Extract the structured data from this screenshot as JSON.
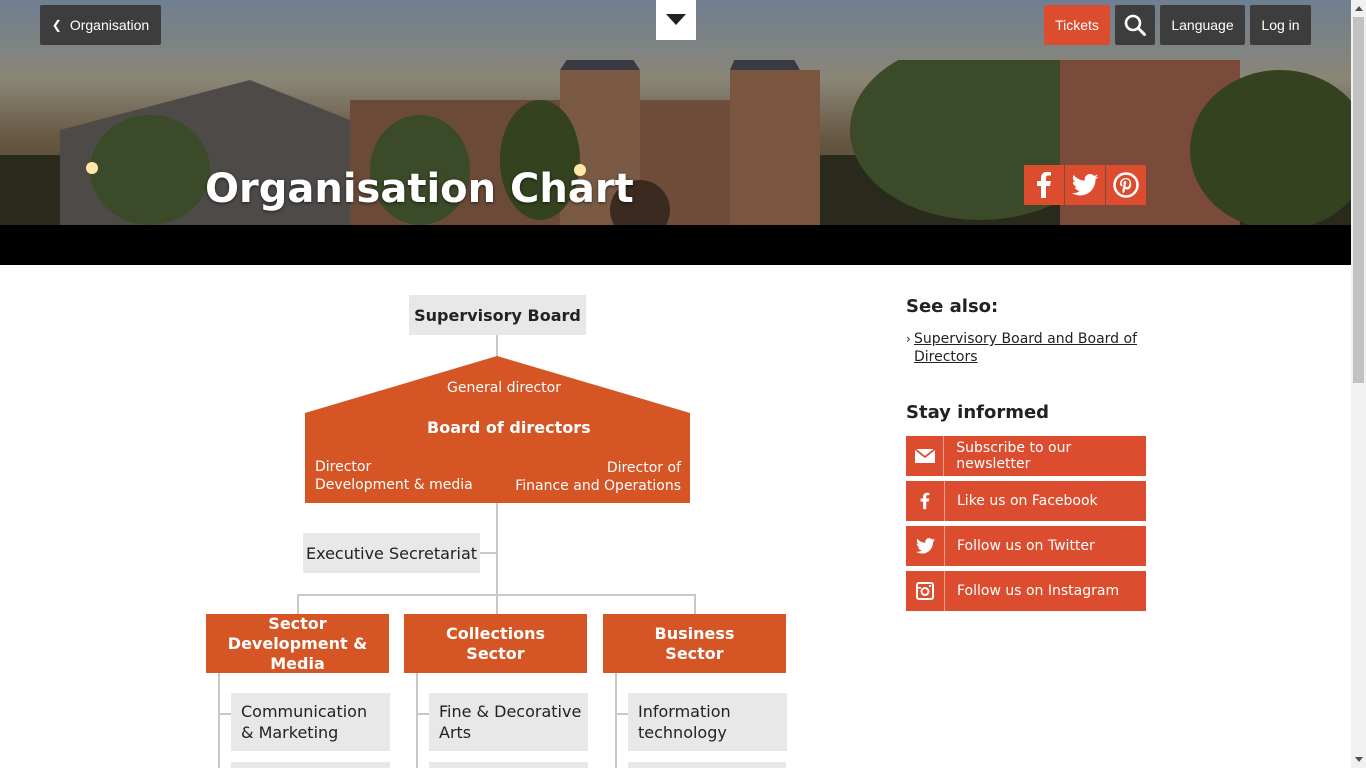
{
  "nav": {
    "back_label": "Organisation",
    "tickets_label": "Tickets",
    "language_label": "Language",
    "login_label": "Log in"
  },
  "hero": {
    "title": "Organisation Chart"
  },
  "org_chart": {
    "supervisory_board": "Supervisory Board",
    "general_director": "General director",
    "board_of_directors": "Board of directors",
    "director_dev_line1": "Director",
    "director_dev_line2": "Development & media",
    "director_fin_line1": "Director of",
    "director_fin_line2": "Finance and Operations",
    "executive_secretariat": "Executive Secretariat",
    "sectors": [
      {
        "line1": "Sector",
        "line2": "Development & Media"
      },
      {
        "line1": "Collections",
        "line2": "Sector"
      },
      {
        "line1": "Business",
        "line2": "Sector"
      }
    ],
    "subunits": [
      {
        "line1": "Communication",
        "line2": "& Marketing"
      },
      {
        "line1": "Fine & Decorative",
        "line2": "Arts"
      },
      {
        "line1": "Information",
        "line2": "technology"
      }
    ]
  },
  "sidebar": {
    "see_also_heading": "See also:",
    "see_also_link": "Supervisory Board and Board of Directors",
    "stay_informed_heading": "Stay informed",
    "social": [
      {
        "label": "Subscribe to our newsletter",
        "icon": "envelope-icon"
      },
      {
        "label": "Like us on Facebook",
        "icon": "facebook-icon"
      },
      {
        "label": "Follow us on Twitter",
        "icon": "twitter-icon"
      },
      {
        "label": "Follow us on Instagram",
        "icon": "instagram-icon"
      }
    ]
  },
  "colors": {
    "accent": "#dc4d2f",
    "chart_orange": "#d55525",
    "grey_box": "#e8e8e8",
    "dark_button": "#3d3d3d"
  }
}
